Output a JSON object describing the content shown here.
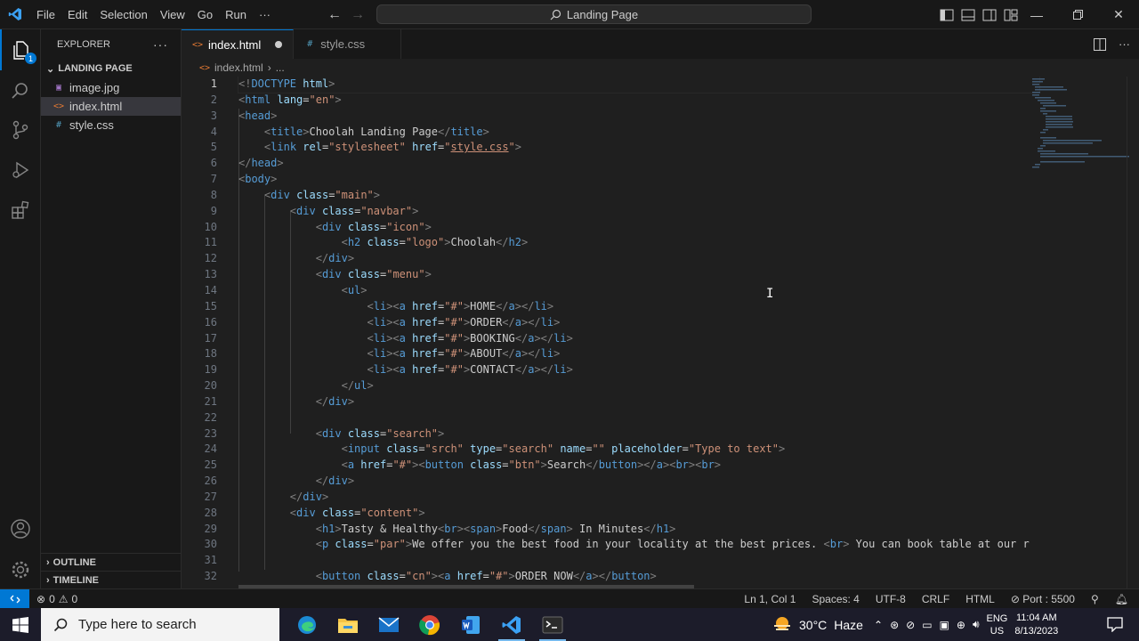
{
  "titlebar": {
    "menus": [
      "File",
      "Edit",
      "Selection",
      "View",
      "Go",
      "Run",
      "···"
    ],
    "search_text": "Landing Page"
  },
  "colors": {
    "accent": "#0078d4",
    "tag": "#569cd6",
    "attr": "#9cdcfe",
    "string": "#ce9178",
    "bracket": "#808080"
  },
  "sidebar": {
    "title": "EXPLORER",
    "folder": "LANDING PAGE",
    "files": [
      {
        "name": "image.jpg",
        "icon": "image-icon"
      },
      {
        "name": "index.html",
        "icon": "html-icon"
      },
      {
        "name": "style.css",
        "icon": "css-icon"
      }
    ],
    "outline": "OUTLINE",
    "timeline": "TIMELINE",
    "badge": "1"
  },
  "tabs": [
    {
      "label": "index.html",
      "icon": "<>",
      "modified": true,
      "active": true
    },
    {
      "label": "style.css",
      "icon": "#",
      "modified": false,
      "active": false
    }
  ],
  "breadcrumb": {
    "file": "index.html",
    "rest": "..."
  },
  "editor": {
    "line_numbers": [
      "1",
      "2",
      "3",
      "4",
      "5",
      "6",
      "7",
      "8",
      "9",
      "10",
      "11",
      "12",
      "13",
      "14",
      "15",
      "16",
      "17",
      "18",
      "19",
      "20",
      "21",
      "22",
      "23",
      "24",
      "25",
      "26",
      "27",
      "28",
      "29",
      "30",
      "31",
      "32"
    ],
    "partial_line_number": "32"
  },
  "statusbar": {
    "problems": "0",
    "warnings": "0",
    "position": "Ln 1, Col 1",
    "spaces": "Spaces: 4",
    "encoding": "UTF-8",
    "eol": "CRLF",
    "language": "HTML",
    "port": "Port : 5500"
  },
  "taskbar": {
    "search_placeholder": "Type here to search",
    "weather_temp": "30°C",
    "weather_text": "Haze",
    "lang_top": "ENG",
    "lang_bottom": "US",
    "time": "11:04 AM",
    "date": "8/13/2023"
  }
}
